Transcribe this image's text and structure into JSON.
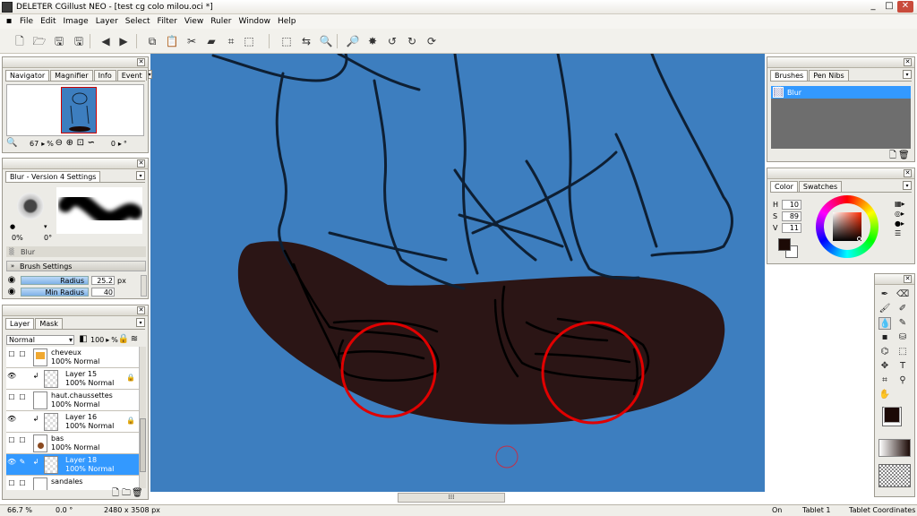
{
  "window": {
    "title": "DELETER CGillust NEO - [test cg colo milou.oci *]",
    "min": "_",
    "max": "□",
    "close": "✕"
  },
  "menu": [
    "File",
    "Edit",
    "Image",
    "Layer",
    "Select",
    "Filter",
    "View",
    "Ruler",
    "Window",
    "Help"
  ],
  "toolbar_icons": [
    "new-file-icon",
    "open-icon",
    "save-icon",
    "save-as-icon",
    "prev-page-icon",
    "next-page-icon",
    "copy-icon",
    "paste-icon",
    "cut-icon",
    "clear-icon",
    "transform-icon",
    "select-all-icon",
    "deselect-icon",
    "invert-selection-icon",
    "zoom-in-icon",
    "zoom-out-icon",
    "fit-icon",
    "rotate-left-icon",
    "rotate-right-icon",
    "rotate-reset-icon"
  ],
  "toolbar_glyphs": [
    "🗋",
    "🗁",
    "🖫",
    "🖫",
    "◀",
    "▶",
    "⧉",
    "📋",
    "✂",
    "▰",
    "⌗",
    "⬚",
    "⬚",
    "⇆",
    "🔍",
    "🔎",
    "✸",
    "↺",
    "↻",
    "⟳"
  ],
  "navigator": {
    "tabs": [
      "Navigator",
      "Magnifier",
      "Info",
      "Event"
    ],
    "zoom": "67",
    "zoom_unit": "%",
    "rotation": "0",
    "rotation_unit": "°"
  },
  "brush_settings": {
    "title": "Blur - Version 4 Settings",
    "opacity": "0%",
    "angle": "0°",
    "brush_name": "Blur",
    "section": "Brush Settings",
    "radius_label": "Radius",
    "radius_value": "25.2",
    "radius_unit": "px",
    "min_radius_label": "Min Radius",
    "min_radius_value": "40"
  },
  "layers": {
    "tabs": [
      "Layer",
      "Mask"
    ],
    "blend_mode": "Normal",
    "opacity": "100",
    "opacity_unit": "%",
    "items": [
      {
        "name": "cheveux",
        "mode": "100% Normal",
        "clip": false,
        "visible": false,
        "selected": false
      },
      {
        "name": "Layer 15",
        "mode": "100% Normal",
        "clip": true,
        "visible": true,
        "selected": false
      },
      {
        "name": "haut.chaussettes",
        "mode": "100% Normal",
        "clip": false,
        "visible": false,
        "selected": false
      },
      {
        "name": "Layer 16",
        "mode": "100% Normal",
        "clip": true,
        "visible": true,
        "selected": false
      },
      {
        "name": "bas",
        "mode": "100% Normal",
        "clip": false,
        "visible": false,
        "selected": false
      },
      {
        "name": "Layer 18",
        "mode": "100% Normal",
        "clip": true,
        "visible": true,
        "selected": true
      },
      {
        "name": "sandales",
        "mode": "",
        "clip": false,
        "visible": false,
        "selected": false
      }
    ]
  },
  "brushes": {
    "tabs": [
      "Brushes",
      "Pen Nibs"
    ],
    "items": [
      "Blur"
    ]
  },
  "color": {
    "tabs": [
      "Color",
      "Swatches"
    ],
    "h_label": "H",
    "h": "10",
    "s_label": "S",
    "s": "89",
    "v_label": "V",
    "v": "11",
    "foreground": "#1c0a06",
    "background": "#ffffff"
  },
  "colors": {
    "canvas_bg": "#3d7ebf",
    "shoes_fill": "#2a0d08",
    "annotation": "#e00000",
    "selection": "#3399ff"
  },
  "status": {
    "zoom": "66.7 %",
    "angle": "0.0 °",
    "size": "2480 x 3508 px",
    "on": "On",
    "tablet": "Tablet 1",
    "coords": "Tablet Coordinates"
  }
}
